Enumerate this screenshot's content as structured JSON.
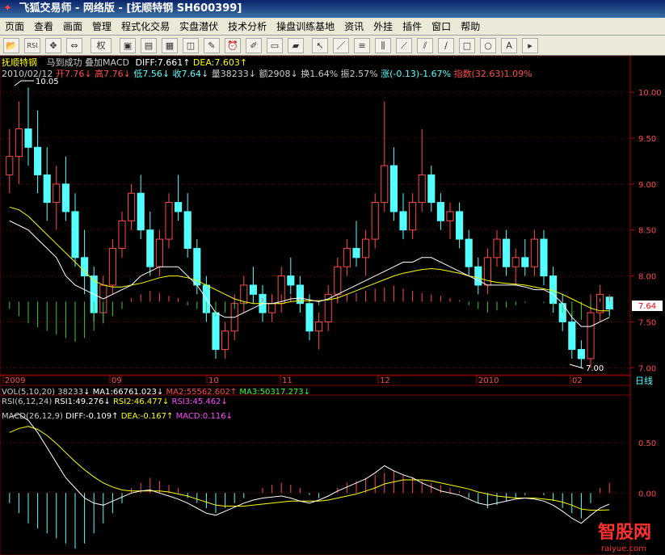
{
  "window": {
    "title": "飞狐交易师 - 网络版 - [抚顺特钢 SH600399]",
    "logo": "飞狐交易师"
  },
  "menu": [
    "页面",
    "查看",
    "画面",
    "管理",
    "程式化交易",
    "实盘潜伏",
    "技术分析",
    "操盘训练基地",
    "资讯",
    "外挂",
    "插件",
    "窗口",
    "帮助"
  ],
  "toolbar": {
    "buttons": [
      "open-icon",
      "rsi-icon",
      "move-icon",
      "swap-icon",
      "weight-icon",
      "layout1-icon",
      "layout2-icon",
      "tile-icon",
      "compare-icon",
      "edit-icon",
      "alarm-icon",
      "pen-icon",
      "notes-icon",
      "chart-icon",
      "pointer-icon",
      "line-icon",
      "channel-icon",
      "vlines-icon",
      "fan-icon",
      "parallel-icon",
      "arc-icon",
      "rect-icon",
      "circle-icon",
      "text-icon",
      "more-icon"
    ],
    "weight_label": "权",
    "text_label": "A"
  },
  "header": {
    "stock_name": "抚顺特钢",
    "overlay_text": "马到成功 叠加MACD",
    "diff_label": "DIFF:7.661",
    "dea_label": "DEA:7.603"
  },
  "quote_line": {
    "date": "2010/02/12",
    "open": "开7.76",
    "high": "高7.76",
    "low": "低7.56",
    "close": "收7.64",
    "volume": "量38233",
    "amount": "额2908",
    "turnover": "换1.64%",
    "amplitude": "振2.57%",
    "change": "涨(-0.13)-1.67%",
    "index": "指数(32.63)1.09%"
  },
  "price_panel": {
    "y_ticks": [
      "10.00",
      "9.50",
      "9.00",
      "8.50",
      "8.00",
      "7.50",
      "7.00"
    ],
    "current_price": "7.64",
    "high_mark": "10.05",
    "low_mark": "7.00",
    "x_labels": [
      "2009",
      "09",
      "10",
      "11",
      "12",
      "2010",
      "02"
    ],
    "period_label": "日线"
  },
  "vol_line": {
    "label": "VOL(5,10,20)",
    "value": "38233",
    "ma1": "MA1:66761.023",
    "ma2": "MA2:55562.602",
    "ma3": "MA3:50317.273"
  },
  "rsi_line": {
    "label": "RSI(6,12,24)",
    "rsi1": "RSI1:49.276",
    "rsi2": "RSI2:46.477",
    "rsi3": "RSI3:45.462"
  },
  "macd_line": {
    "label": "MACD(26,12,9)",
    "diff": "DIFF:-0.109",
    "dea": "DEA:-0.167",
    "macd": "MACD:0.116"
  },
  "macd_panel": {
    "y_ticks": [
      "0.50",
      "0.00"
    ]
  },
  "watermark": {
    "brand": "智股网",
    "url": "raiyue.com"
  },
  "colors": {
    "up": "#ff4a4a",
    "down": "#54ffff",
    "grid": "#7a0000",
    "ma_white": "#ffffff",
    "ma_yellow": "#ffff00",
    "green": "#33cc33"
  },
  "chart_data": {
    "type": "candlestick",
    "candles": [
      [
        9.1,
        9.6,
        8.9,
        9.3
      ],
      [
        9.3,
        9.9,
        9.0,
        9.6
      ],
      [
        9.6,
        10.05,
        9.2,
        9.4
      ],
      [
        9.4,
        9.8,
        8.9,
        9.1
      ],
      [
        9.1,
        9.4,
        8.6,
        8.8
      ],
      [
        8.8,
        9.2,
        8.5,
        9.0
      ],
      [
        9.0,
        9.3,
        8.6,
        8.7
      ],
      [
        8.7,
        8.9,
        8.1,
        8.2
      ],
      [
        8.2,
        8.5,
        7.8,
        8.0
      ],
      [
        8.0,
        8.1,
        7.5,
        7.6
      ],
      [
        7.6,
        8.0,
        7.5,
        7.9
      ],
      [
        7.9,
        8.4,
        7.8,
        8.3
      ],
      [
        8.3,
        8.7,
        8.2,
        8.6
      ],
      [
        8.6,
        9.0,
        8.5,
        8.9
      ],
      [
        8.9,
        9.1,
        8.4,
        8.5
      ],
      [
        8.5,
        8.7,
        8.0,
        8.1
      ],
      [
        8.1,
        8.5,
        8.0,
        8.4
      ],
      [
        8.4,
        8.9,
        8.3,
        8.8
      ],
      [
        8.8,
        9.1,
        8.6,
        8.7
      ],
      [
        8.7,
        8.9,
        8.2,
        8.3
      ],
      [
        8.3,
        8.4,
        7.8,
        7.9
      ],
      [
        7.9,
        8.0,
        7.5,
        7.6
      ],
      [
        7.6,
        7.7,
        7.1,
        7.2
      ],
      [
        7.2,
        7.5,
        7.1,
        7.4
      ],
      [
        7.4,
        7.8,
        7.3,
        7.7
      ],
      [
        7.7,
        8.0,
        7.6,
        7.9
      ],
      [
        7.9,
        8.1,
        7.7,
        7.8
      ],
      [
        7.8,
        7.9,
        7.5,
        7.6
      ],
      [
        7.6,
        7.8,
        7.5,
        7.7
      ],
      [
        7.7,
        8.1,
        7.6,
        8.0
      ],
      [
        8.0,
        8.2,
        7.8,
        7.9
      ],
      [
        7.9,
        8.0,
        7.6,
        7.7
      ],
      [
        7.7,
        7.8,
        7.3,
        7.4
      ],
      [
        7.4,
        7.6,
        7.2,
        7.5
      ],
      [
        7.5,
        7.9,
        7.4,
        7.8
      ],
      [
        7.8,
        8.2,
        7.7,
        8.1
      ],
      [
        8.1,
        8.4,
        8.0,
        8.3
      ],
      [
        8.3,
        8.6,
        8.1,
        8.2
      ],
      [
        8.2,
        8.5,
        8.0,
        8.4
      ],
      [
        8.4,
        8.9,
        8.3,
        8.8
      ],
      [
        8.8,
        9.9,
        8.7,
        9.2
      ],
      [
        9.2,
        9.4,
        8.6,
        8.7
      ],
      [
        8.7,
        8.9,
        8.4,
        8.5
      ],
      [
        8.5,
        8.9,
        8.4,
        8.8
      ],
      [
        8.8,
        9.6,
        8.7,
        9.1
      ],
      [
        9.1,
        9.2,
        8.7,
        8.8
      ],
      [
        8.8,
        8.9,
        8.5,
        8.6
      ],
      [
        8.6,
        8.8,
        8.4,
        8.7
      ],
      [
        8.7,
        8.8,
        8.3,
        8.4
      ],
      [
        8.4,
        8.5,
        8.0,
        8.1
      ],
      [
        8.1,
        8.2,
        7.8,
        7.9
      ],
      [
        7.9,
        8.3,
        7.8,
        8.2
      ],
      [
        8.2,
        8.5,
        8.1,
        8.4
      ],
      [
        8.4,
        8.5,
        8.0,
        8.1
      ],
      [
        8.1,
        8.3,
        7.9,
        8.2
      ],
      [
        8.2,
        8.4,
        8.0,
        8.1
      ],
      [
        8.1,
        8.5,
        8.0,
        8.4
      ],
      [
        8.4,
        8.5,
        7.9,
        8.0
      ],
      [
        8.0,
        8.1,
        7.6,
        7.7
      ],
      [
        7.7,
        7.8,
        7.4,
        7.5
      ],
      [
        7.5,
        7.6,
        7.1,
        7.2
      ],
      [
        7.2,
        7.3,
        7.0,
        7.1
      ],
      [
        7.1,
        7.8,
        7.0,
        7.6
      ],
      [
        7.6,
        7.9,
        7.5,
        7.8
      ],
      [
        7.77,
        7.76,
        7.56,
        7.64
      ]
    ],
    "ma_white": [
      8.6,
      8.55,
      8.5,
      8.4,
      8.3,
      8.2,
      8.0,
      7.9,
      7.85,
      7.8,
      7.75,
      7.8,
      7.85,
      7.9,
      8.0,
      8.05,
      8.1,
      8.1,
      8.1,
      8.0,
      7.9,
      7.75,
      7.6,
      7.55,
      7.55,
      7.6,
      7.65,
      7.7,
      7.7,
      7.72,
      7.75,
      7.76,
      7.74,
      7.72,
      7.75,
      7.8,
      7.85,
      7.9,
      7.95,
      8.0,
      8.05,
      8.1,
      8.15,
      8.15,
      8.2,
      8.2,
      8.15,
      8.1,
      8.05,
      8.0,
      7.95,
      7.9,
      7.9,
      7.9,
      7.9,
      7.88,
      7.85,
      7.85,
      7.8,
      7.7,
      7.55,
      7.45,
      7.45,
      7.5,
      7.55
    ],
    "ma_yellow": [
      8.75,
      8.72,
      8.65,
      8.55,
      8.45,
      8.35,
      8.25,
      8.15,
      8.05,
      7.95,
      7.9,
      7.88,
      7.88,
      7.9,
      7.92,
      7.95,
      7.98,
      8.0,
      8.0,
      7.98,
      7.95,
      7.9,
      7.85,
      7.8,
      7.75,
      7.72,
      7.7,
      7.7,
      7.7,
      7.7,
      7.72,
      7.73,
      7.73,
      7.73,
      7.74,
      7.76,
      7.8,
      7.84,
      7.88,
      7.92,
      7.96,
      8.0,
      8.03,
      8.05,
      8.07,
      8.08,
      8.07,
      8.05,
      8.03,
      8.0,
      7.98,
      7.95,
      7.93,
      7.92,
      7.91,
      7.9,
      7.88,
      7.86,
      7.84,
      7.8,
      7.75,
      7.7,
      7.65,
      7.62,
      7.62
    ],
    "macd_bars": [
      -0.1,
      -0.2,
      -0.3,
      -0.35,
      -0.4,
      -0.45,
      -0.5,
      -0.55,
      -0.5,
      -0.4,
      -0.3,
      -0.2,
      -0.1,
      0.05,
      0.1,
      0.15,
      0.12,
      0.08,
      0.05,
      -0.05,
      -0.1,
      -0.15,
      -0.2,
      -0.15,
      -0.1,
      -0.05,
      0.0,
      0.05,
      0.08,
      0.1,
      0.08,
      0.05,
      -0.02,
      -0.05,
      0.0,
      0.05,
      0.1,
      0.12,
      0.15,
      0.18,
      0.2,
      0.22,
      0.18,
      0.15,
      0.12,
      0.1,
      0.08,
      0.05,
      0.02,
      -0.05,
      -0.1,
      -0.15,
      -0.12,
      -0.08,
      -0.05,
      -0.02,
      0.0,
      -0.02,
      -0.08,
      -0.15,
      -0.2,
      -0.25,
      -0.1,
      0.05,
      0.1,
      0.116
    ],
    "macd_diff": [
      0.75,
      0.78,
      0.72,
      0.6,
      0.45,
      0.3,
      0.15,
      0.05,
      -0.05,
      -0.1,
      -0.12,
      -0.08,
      -0.04,
      0.0,
      0.02,
      0.03,
      0.0,
      -0.03,
      -0.06,
      -0.1,
      -0.15,
      -0.2,
      -0.22,
      -0.18,
      -0.14,
      -0.1,
      -0.07,
      -0.05,
      -0.04,
      -0.03,
      -0.05,
      -0.08,
      -0.1,
      -0.07,
      -0.03,
      0.02,
      0.06,
      0.1,
      0.14,
      0.2,
      0.27,
      0.22,
      0.18,
      0.15,
      0.1,
      0.06,
      0.02,
      0.0,
      -0.02,
      -0.06,
      -0.1,
      -0.12,
      -0.1,
      -0.08,
      -0.06,
      -0.05,
      -0.06,
      -0.08,
      -0.12,
      -0.18,
      -0.25,
      -0.3,
      -0.22,
      -0.15,
      -0.109
    ],
    "macd_dea": [
      0.6,
      0.64,
      0.66,
      0.63,
      0.57,
      0.49,
      0.4,
      0.31,
      0.23,
      0.16,
      0.1,
      0.06,
      0.03,
      0.02,
      0.02,
      0.02,
      0.02,
      0.01,
      -0.01,
      -0.03,
      -0.06,
      -0.09,
      -0.12,
      -0.13,
      -0.13,
      -0.13,
      -0.12,
      -0.11,
      -0.1,
      -0.09,
      -0.08,
      -0.08,
      -0.08,
      -0.08,
      -0.07,
      -0.05,
      -0.03,
      -0.01,
      0.02,
      0.05,
      0.09,
      0.11,
      0.13,
      0.13,
      0.13,
      0.12,
      0.1,
      0.08,
      0.06,
      0.04,
      0.01,
      -0.01,
      -0.03,
      -0.04,
      -0.05,
      -0.05,
      -0.05,
      -0.06,
      -0.07,
      -0.09,
      -0.12,
      -0.16,
      -0.17,
      -0.17,
      -0.167
    ],
    "y_range": [
      6.95,
      10.15
    ],
    "macd_range": [
      -0.55,
      0.85
    ]
  }
}
